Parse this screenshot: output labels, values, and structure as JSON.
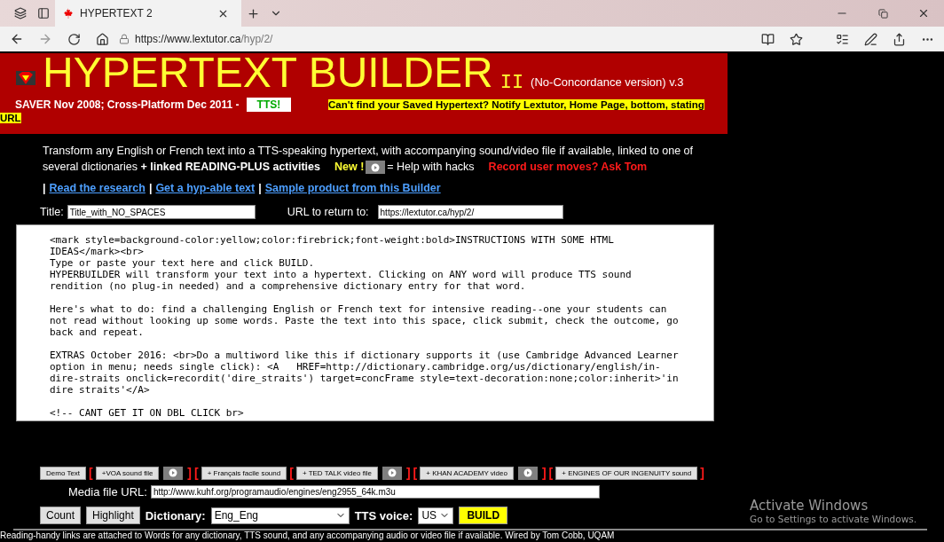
{
  "browser": {
    "tabs": [
      {
        "title": "HYPERTEXT 2",
        "selected": true
      }
    ],
    "url_host": "https://www.lextutor.ca",
    "url_path": "/hyp/2/"
  },
  "header": {
    "title": "HYPERTEXT BUILDER",
    "version_mark": "II",
    "subtitle": "(No-Concordance version) v.3",
    "saver": "SAVER Nov 2008; Cross-Platform Dec 2011 -",
    "tts_badge": "TTS!",
    "notice": [
      "Can't find your Saved Hypertext? Notify Lextutor, Home Page, bottom, stating",
      "URL"
    ]
  },
  "intro": {
    "lines": [
      "Transform any English or French text into a TTS-speaking hypertext, with accompanying sound/video file if available, linked to one of",
      "several dictionaries **+ linked READING-PLUS activities**"
    ],
    "new_label": "New !",
    "help": "= Help with hacks",
    "record": "Record user moves? Ask Tom"
  },
  "links": [
    {
      "prefix": "|",
      "label": "Read the research"
    },
    {
      "prefix": "|",
      "label": "Get a hyp-able text"
    },
    {
      "prefix": "|",
      "label": "Sample product from this Builder"
    }
  ],
  "form": {
    "title_label": "Title:",
    "title_value": "Title_with_NO_SPACES",
    "url_label": "URL to return to:",
    "url_value": "https://lextutor.ca/hyp/2/",
    "body": "<mark style=background-color:yellow;color:firebrick;font-weight:bold>INSTRUCTIONS WITH SOME HTML IDEAS</mark><br>\nType or paste your text here and click BUILD.\nHYPERBUILDER will transform your text into a hypertext. Clicking on ANY word will produce TTS sound rendition (no plug-in needed) and a comprehensive dictionary entry for that word.\n\nHere's what to do: find a challenging English or French text for intensive reading--one your students can not read without looking up some words. Paste the text into this space, click submit, check the outcome, go back and repeat.\n\nEXTRAS October 2016: <br>Do a multiword like this if dictionary supports it (use Cambridge Advanced Learner option in menu; needs single click): <A   HREF=http://dictionary.cambridge.org/us/dictionary/english/in-dire-straits onclick=recordit('dire_straits') target=concFrame style=text-decoration:none;color:inherit>'in dire straits'</A>\n\n<!-- CANT GET IT ON DBL CLICK br>"
  },
  "media_buttons": [
    {
      "kind": "button",
      "label": "Demo Text"
    },
    {
      "kind": "bracket",
      "label": "["
    },
    {
      "kind": "button",
      "label": "+VOA sound file"
    },
    {
      "kind": "play"
    },
    {
      "kind": "bracket",
      "label": "]"
    },
    {
      "kind": "bracket",
      "label": "["
    },
    {
      "kind": "button",
      "label": "+ Français facile sound"
    },
    {
      "kind": "bracket",
      "label": "["
    },
    {
      "kind": "button",
      "label": "+ TED TALK video file"
    },
    {
      "kind": "play"
    },
    {
      "kind": "bracket",
      "label": "]"
    },
    {
      "kind": "bracket",
      "label": "["
    },
    {
      "kind": "button",
      "label": "+ KHAN ACADEMY video"
    },
    {
      "kind": "play"
    },
    {
      "kind": "bracket",
      "label": "]"
    },
    {
      "kind": "bracket",
      "label": "["
    },
    {
      "kind": "button",
      "label": "+ ENGINES OF OUR INGENUITY sound"
    },
    {
      "kind": "bracket",
      "label": "]"
    }
  ],
  "media": {
    "label": "Media file URL:",
    "value": "http://www.kuhf.org/programaudio/engines/eng2955_64k.m3u"
  },
  "controls": {
    "count": "Count",
    "highlight": "Highlight",
    "dictionary_label": "Dictionary:",
    "dictionary_value": "Eng_Eng",
    "voice_label": "TTS voice:",
    "voice_value": "US",
    "build": "BUILD"
  },
  "footer": "Reading-handy links are attached to Words for any dictionary, TTS sound, and any accompanying audio or video file if available. Wired by Tom Cobb, UQAM",
  "watermark": {
    "title": "Activate Windows",
    "subtitle": "Go to Settings to activate Windows."
  }
}
